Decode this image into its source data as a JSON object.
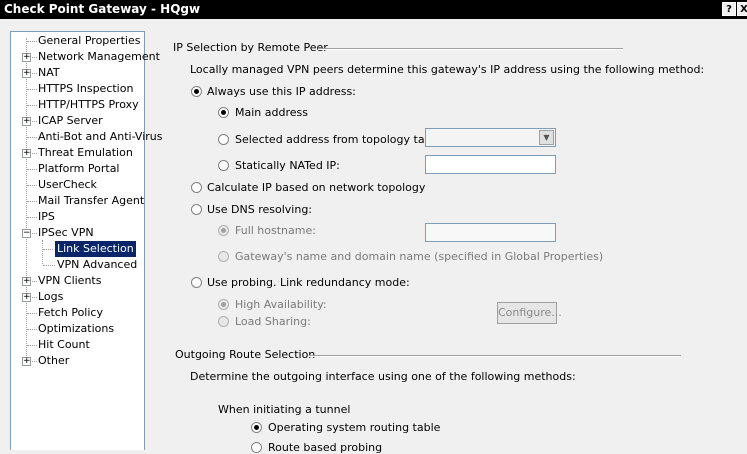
{
  "window": {
    "title": "Check Point Gateway - HQgw",
    "help_label": "?",
    "close_label": "X"
  },
  "tree": {
    "items": [
      {
        "label": "General Properties",
        "expandable": false
      },
      {
        "label": "Network Management",
        "expandable": true
      },
      {
        "label": "NAT",
        "expandable": true
      },
      {
        "label": "HTTPS Inspection",
        "expandable": false
      },
      {
        "label": "HTTP/HTTPS Proxy",
        "expandable": false
      },
      {
        "label": "ICAP Server",
        "expandable": true
      },
      {
        "label": "Anti-Bot and Anti-Virus",
        "expandable": false
      },
      {
        "label": "Threat Emulation",
        "expandable": true
      },
      {
        "label": "Platform Portal",
        "expandable": false
      },
      {
        "label": "UserCheck",
        "expandable": false
      },
      {
        "label": "Mail Transfer Agent",
        "expandable": false
      },
      {
        "label": "IPS",
        "expandable": false
      },
      {
        "label": "IPSec VPN",
        "expandable": true,
        "expanded": true
      },
      {
        "label": "Link Selection",
        "child": true,
        "selected": true
      },
      {
        "label": "VPN Advanced",
        "child": true
      },
      {
        "label": "VPN Clients",
        "expandable": true
      },
      {
        "label": "Logs",
        "expandable": true
      },
      {
        "label": "Fetch Policy",
        "expandable": false
      },
      {
        "label": "Optimizations",
        "expandable": false
      },
      {
        "label": "Hit Count",
        "expandable": false
      },
      {
        "label": "Other",
        "expandable": true
      }
    ]
  },
  "ip_selection": {
    "heading": "IP Selection by Remote Peer",
    "description": "Locally managed VPN peers determine this gateway's IP address using the following method:",
    "always_use": "Always use this IP address:",
    "main_address": "Main address",
    "selected_from_topology": "Selected address from topology table:",
    "statically_nated": "Statically NATed IP:",
    "calculate_ip": "Calculate IP based on network topology",
    "use_dns": "Use DNS resolving:",
    "full_hostname": "Full hostname:",
    "gateway_name": "Gateway's name and domain name (specified in Global Properties)",
    "use_probing": "Use probing. Link redundancy mode:",
    "high_availability": "High Availability:",
    "load_sharing": "Load Sharing:",
    "configure_button": "Configure...",
    "topology_select_value": "",
    "static_nat_value": "",
    "hostname_value": ""
  },
  "outgoing": {
    "heading": "Outgoing Route Selection",
    "description": "Determine the outgoing interface using one of the following methods:",
    "when_initiating": "When initiating a tunnel",
    "os_routing": "Operating system routing table",
    "route_probing": "Route based probing"
  }
}
